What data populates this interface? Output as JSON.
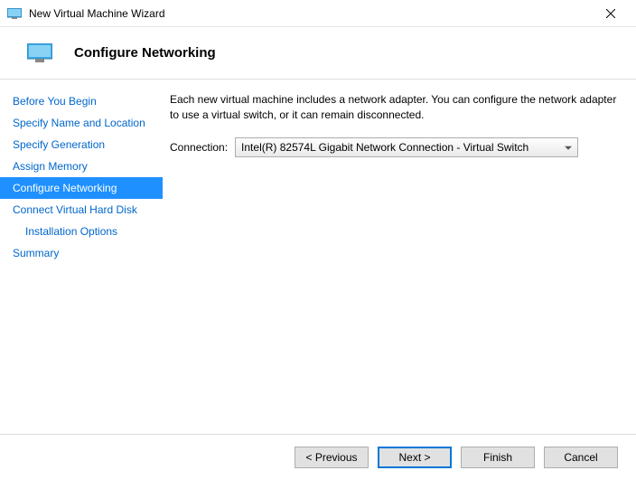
{
  "window": {
    "title": "New Virtual Machine Wizard"
  },
  "header": {
    "title": "Configure Networking"
  },
  "sidebar": {
    "items": [
      {
        "label": "Before You Begin",
        "selected": false,
        "indent": false
      },
      {
        "label": "Specify Name and Location",
        "selected": false,
        "indent": false
      },
      {
        "label": "Specify Generation",
        "selected": false,
        "indent": false
      },
      {
        "label": "Assign Memory",
        "selected": false,
        "indent": false
      },
      {
        "label": "Configure Networking",
        "selected": true,
        "indent": false
      },
      {
        "label": "Connect Virtual Hard Disk",
        "selected": false,
        "indent": false
      },
      {
        "label": "Installation Options",
        "selected": false,
        "indent": true
      },
      {
        "label": "Summary",
        "selected": false,
        "indent": false
      }
    ]
  },
  "content": {
    "description": "Each new virtual machine includes a network adapter. You can configure the network adapter to use a virtual switch, or it can remain disconnected.",
    "connection_label": "Connection:",
    "connection_value": "Intel(R) 82574L Gigabit Network Connection - Virtual Switch"
  },
  "footer": {
    "previous": "< Previous",
    "next": "Next >",
    "finish": "Finish",
    "cancel": "Cancel"
  }
}
